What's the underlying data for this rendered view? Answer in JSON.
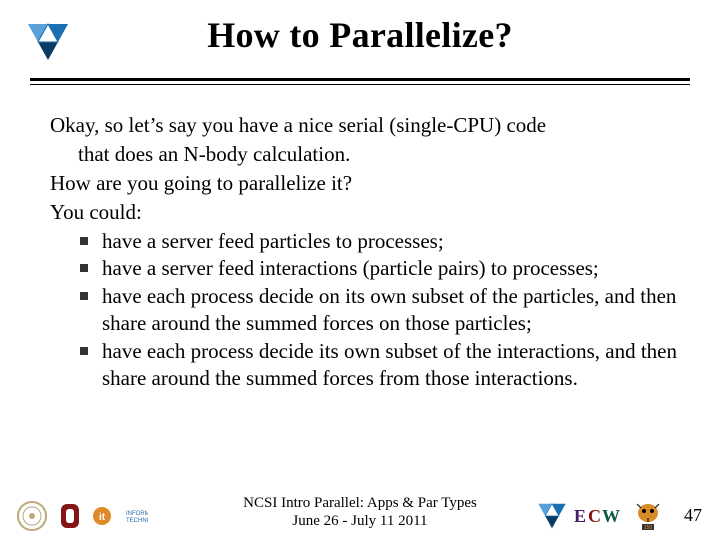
{
  "colors": {
    "primary_logo_blue": "#1a6fb3",
    "primary_logo_dark": "#0a3a66",
    "ou_crimson": "#841617",
    "ecu_purple": "#4a1a6b",
    "wayne_green": "#0c5a3e",
    "seal_tan": "#b9a97a",
    "it_orange": "#e08a2a",
    "it_blue": "#2a6fb0"
  },
  "title": "How to Parallelize?",
  "intro": {
    "line1": "Okay, so let’s say you have a nice serial (single-CPU) code",
    "line2": "that does an N-body calculation.",
    "line3": "How are you going to parallelize it?",
    "line4": "You could:"
  },
  "bullets": [
    "have a server feed particles to processes;",
    "have a server feed interactions (particle pairs) to processes;",
    "have each process decide on its own subset of the particles, and then share around the summed forces on those particles;",
    "have each process decide its own subset of the interactions, and then share around the summed forces from those interactions."
  ],
  "footer": {
    "line1": "NCSI Intro Parallel: Apps & Par Types",
    "line2": "June 26 - July 11 2011",
    "page": "47"
  },
  "icons": {
    "header_logo": "triangle-logo-icon",
    "footer_left": [
      "seal-icon",
      "ou-logo-icon",
      "it-logo-icon"
    ],
    "footer_right": [
      "triangle-logo-icon",
      "ecw-logo-icon",
      "tiger-logo-icon"
    ]
  }
}
